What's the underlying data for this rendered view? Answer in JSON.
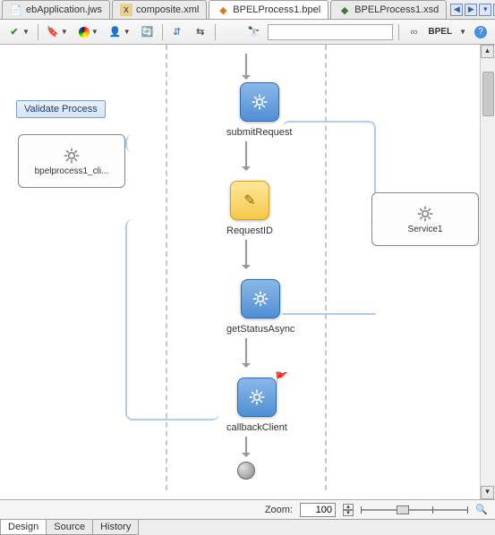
{
  "tabs": {
    "t1": "ebApplication.jws",
    "t2": "composite.xml",
    "t3": "BPELProcess1.bpel",
    "t4": "BPELProcess1.xsd"
  },
  "toolbar": {
    "bpel_label": "BPEL"
  },
  "validate_label": "Validate Process",
  "nodes": {
    "submitRequest": "submitRequest",
    "requestId": "RequestID",
    "getStatusAsync": "getStatusAsync",
    "callbackClient": "callbackClient"
  },
  "partners": {
    "client": "bpelprocess1_cli...",
    "service": "Service1"
  },
  "zoom": {
    "label": "Zoom:",
    "value": "100"
  },
  "bottom_tabs": {
    "design": "Design",
    "source": "Source",
    "history": "History"
  }
}
